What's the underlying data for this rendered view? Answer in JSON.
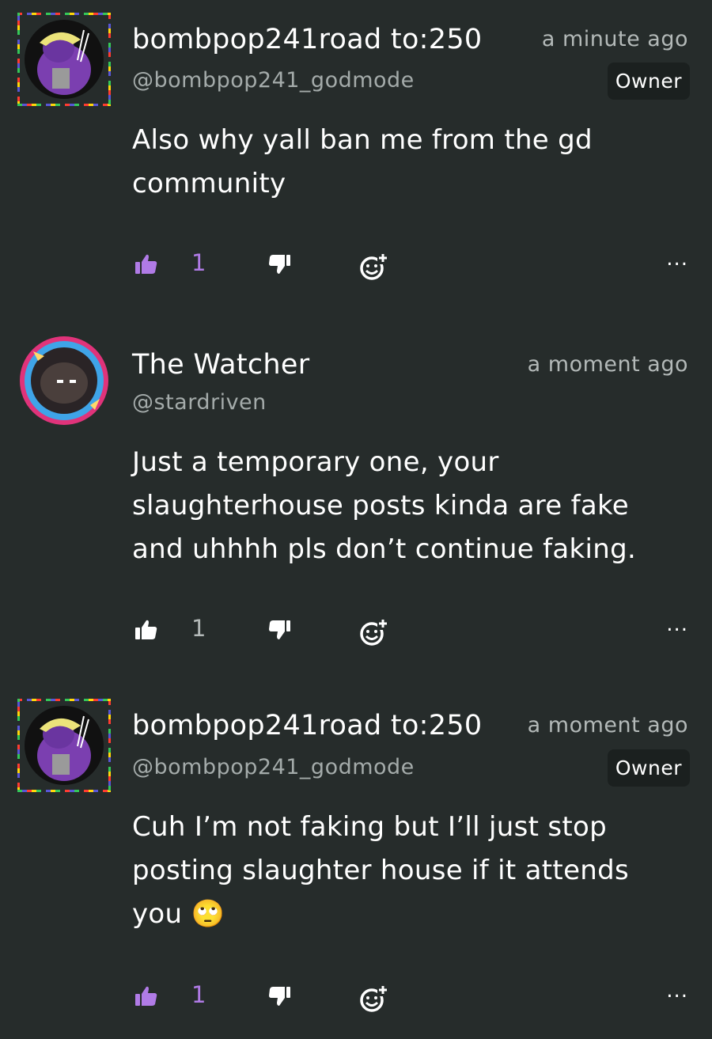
{
  "comments": [
    {
      "display_name": "bombpop241road to:250",
      "handle": "@bombpop241_godmode",
      "time": "a minute ago",
      "badge": "Owner",
      "text": "Also why yall ban me from the gd community",
      "likes": "1",
      "liked": true,
      "more": "..."
    },
    {
      "display_name": "The Watcher",
      "handle": "@stardriven",
      "time": "a moment ago",
      "badge": "",
      "text": "Just a temporary one, your slaughterhouse posts kinda are fake and uhhhh pls don’t continue faking.",
      "likes": "1",
      "liked": false,
      "more": "..."
    },
    {
      "display_name": "bombpop241road to:250",
      "handle": "@bombpop241_godmode",
      "time": "a moment ago",
      "badge": "Owner",
      "text": "Cuh I’m not faking but I’ll just stop posting slaughter house if it attends you",
      "emoji": "🙄",
      "likes": "1",
      "liked": true,
      "more": "..."
    }
  ],
  "colors": {
    "background": "#262c2b",
    "liked": "#b07be6",
    "text": "#ffffff",
    "muted": "#b3b9b8"
  }
}
